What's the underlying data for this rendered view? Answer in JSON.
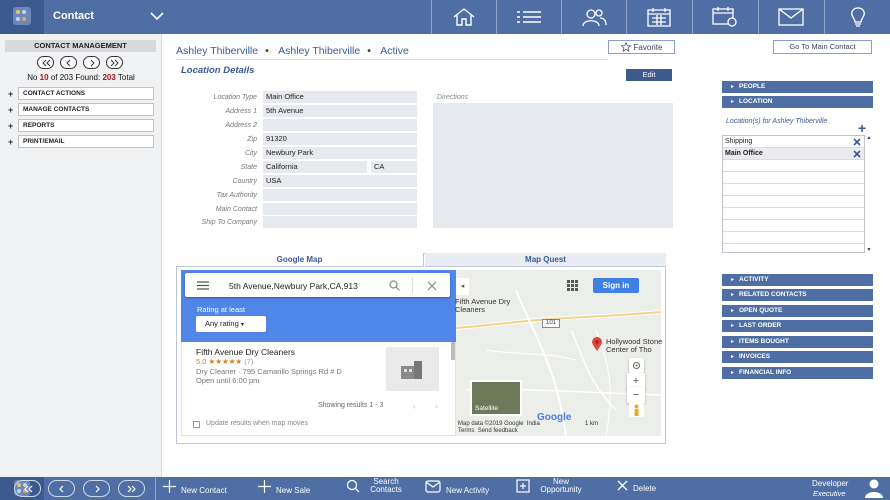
{
  "app": {
    "title": "Contact"
  },
  "nav_icons": [
    "home-icon",
    "list-icon",
    "people-icon",
    "calendar-icon",
    "calendar-gear-icon",
    "mail-icon",
    "lightbulb-icon"
  ],
  "left": {
    "title": "CONTACT MANAGEMENT",
    "record": {
      "no_label": "No",
      "index": "10",
      "of_label": "of",
      "total": "203",
      "found_label": "Found:",
      "found": "203",
      "total_label": "Total"
    },
    "buttons": [
      "CONTACT ACTIONS",
      "MANAGE CONTACTS",
      "REPORTS",
      "PRINT/EMAIL"
    ]
  },
  "header": {
    "name1": "Ashley Thiberville",
    "name2": "Ashley Thiberville",
    "status": "Active",
    "favorite": "Favorite",
    "main_contact": "Go To Main Contact"
  },
  "section": {
    "title": "Location Details",
    "edit": "Edit"
  },
  "form": {
    "labels": [
      "Location Type",
      "Address 1",
      "Address 2",
      "Zip",
      "City",
      "State",
      "Country",
      "Tax Authority",
      "Main Contact",
      "Ship To Company"
    ],
    "location_type": "Main Office",
    "address1": "5th Avenue",
    "address2": "",
    "zip": "91320",
    "city": "Newbury Park",
    "state": "California",
    "state_code": "CA",
    "country": "USA",
    "tax_authority": "",
    "main_contact": "",
    "ship_to": "",
    "directions_label": "Directions",
    "directions": ""
  },
  "map": {
    "tabs": [
      "Google Map",
      "Map Quest"
    ],
    "query": "5th Avenue,Newbury Park,CA,913",
    "rating_label": "Rating at least",
    "rating_value": "Any rating",
    "result_name": "Fifth Avenue Dry Cleaners",
    "result_rating": "5.0",
    "result_stars": "★★★★★",
    "result_count": "(7)",
    "result_address": "Dry Cleaner · 795 Camarillo Springs Rd # D",
    "result_hours": "Open until 6:00 pm",
    "showing": "Showing results 1 - 3",
    "update": "Update results when map moves",
    "sign_in": "Sign in",
    "place1": "Fifth Avenue Dry Cleaners",
    "place2": "Hollywood Stone Center of Tho",
    "road": "101",
    "satellite": "Satellite",
    "google": "Google",
    "map_data": "Map data ©2019 Google",
    "india": "India",
    "terms": "Terms",
    "feedback": "Send feedback",
    "scale": "1 km"
  },
  "right": {
    "top_buttons": [
      "PEOPLE",
      "LOCATION"
    ],
    "locations_for": "Location(s) for Ashley Thiberville",
    "locations": [
      "Shipping",
      "Main Office"
    ],
    "buttons": [
      "ACTIVITY",
      "RELATED CONTACTS",
      "OPEN QUOTE",
      "LAST ORDER",
      "ITEMS BOUGHT",
      "INVOICES",
      "FINANCIAL INFO"
    ]
  },
  "bottom": {
    "actions": [
      "New Contact",
      "New Sale",
      "Search Contacts",
      "New Activity",
      "New Opportunity",
      "Delete"
    ],
    "user_name": "Developer",
    "user_role": "Executive"
  },
  "colors": {
    "primary": "#4f6ea3",
    "dark": "#3c5a8e",
    "accent_red": "#b01010",
    "map_blue": "#4f86e8"
  }
}
